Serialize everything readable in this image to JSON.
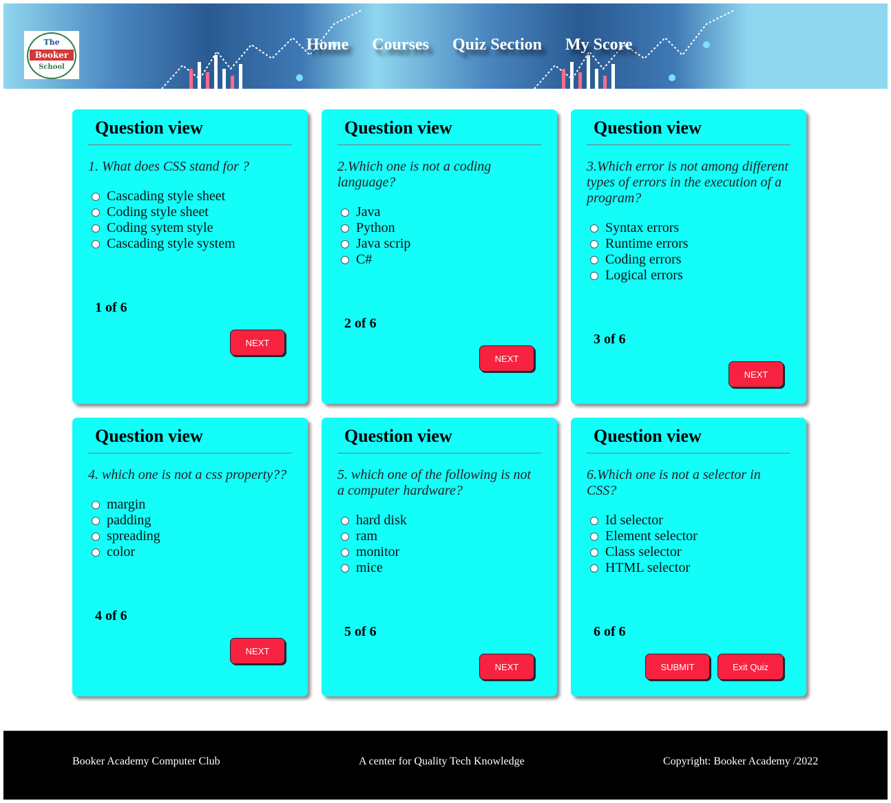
{
  "header": {
    "logo": {
      "line1": "The",
      "line2": "Booker",
      "line3": "School"
    },
    "nav": [
      "Home",
      "Courses",
      "Quiz Section",
      "My Score"
    ]
  },
  "cards": [
    {
      "title": "Question view",
      "question": "1. What does CSS stand for ?",
      "options": [
        "Cascading style sheet",
        "Coding style sheet",
        "Coding sytem style",
        "Cascading style system"
      ],
      "counter": "1 of 6",
      "buttons": [
        "NEXT"
      ]
    },
    {
      "title": "Question view",
      "question": "2.Which one is not a coding language?",
      "options": [
        "Java",
        "Python",
        "Java scrip",
        "C#"
      ],
      "counter": "2 of 6",
      "buttons": [
        "NEXT"
      ]
    },
    {
      "title": "Question view",
      "question": "3.Which error is not among different types of errors in the execution of a program?",
      "options": [
        "Syntax errors",
        "Runtime errors",
        "Coding errors",
        "Logical errors"
      ],
      "counter": "3 of 6",
      "buttons": [
        "NEXT"
      ]
    },
    {
      "title": "Question view",
      "question": "4. which one is not a css property??",
      "options": [
        "margin",
        "padding",
        "spreading",
        "color"
      ],
      "counter": "4 of 6",
      "buttons": [
        "NEXT"
      ]
    },
    {
      "title": "Question view",
      "question": "5. which one of the following is not a computer hardware?",
      "options": [
        "hard disk",
        "ram",
        "monitor",
        "mice"
      ],
      "counter": "5 of 6",
      "buttons": [
        "NEXT"
      ]
    },
    {
      "title": "Question view",
      "question": "6.Which one is not a selector in CSS?",
      "options": [
        "Id selector",
        "Element selector",
        "Class selector",
        "HTML selector"
      ],
      "counter": "6 of 6",
      "buttons": [
        "SUBMIT",
        "Exit Quiz"
      ]
    }
  ],
  "footer": {
    "left": "Booker Academy Computer Club",
    "center": "A center for Quality Tech Knowledge",
    "right": "Copyright: Booker Academy /2022"
  },
  "colors": {
    "card_bg": "#13fdf9",
    "button_bg": "#f7223f",
    "header_bg": "#8fd6ef",
    "footer_bg": "#000000"
  }
}
